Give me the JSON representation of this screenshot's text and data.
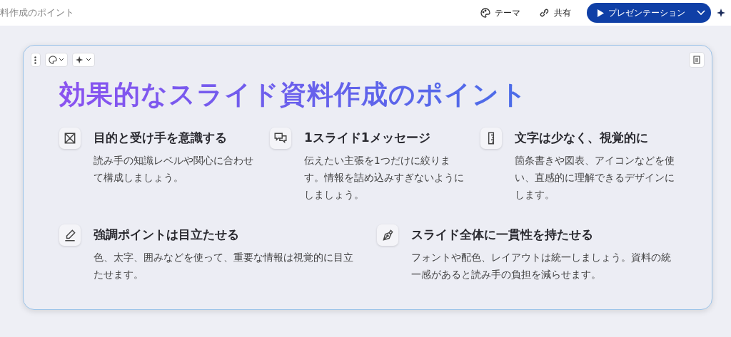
{
  "top_bar": {
    "document_title": "料作成のポイント",
    "theme_button": "テーマ",
    "share_button": "共有",
    "present_button": "プレゼンテーション"
  },
  "slide": {
    "title": "効果的なスライド資料作成のポイント",
    "rows": [
      [
        {
          "heading": "目的と受け手を意識する",
          "text": "読み手の知識レベルや関心に合わせて構成しましょう。"
        },
        {
          "heading": "1スライド1メッセージ",
          "text": "伝えたい主張を1つだけに絞ります。情報を詰め込みすぎないようにしましょう。"
        },
        {
          "heading": "文字は少なく、視覚的に",
          "text": "箇条書きや図表、アイコンなどを使い、直感的に理解できるデザインにします。"
        }
      ],
      [
        {
          "heading": "強調ポイントは目立たせる",
          "text": "色、太字、囲みなどを使って、重要な情報は視覚的に目立たせます。"
        },
        {
          "heading": "スライド全体に一貫性を持たせる",
          "text": "フォントや配色、レイアウトは統一しましょう。資料の統一感があると読み手の負担を減らせます。"
        }
      ]
    ]
  }
}
